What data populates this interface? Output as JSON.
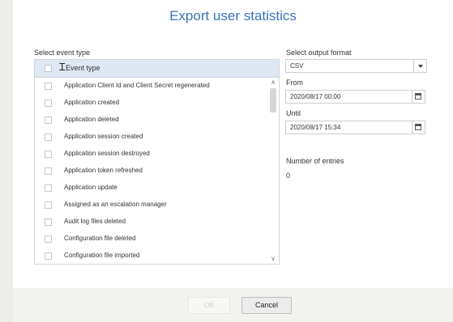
{
  "dialog": {
    "title": "Export user statistics",
    "ok_label": "OK",
    "cancel_label": "Cancel"
  },
  "event_type": {
    "label": "Select event type",
    "header": "Event type",
    "items": [
      "Application Client Id and Client Secret regenerated",
      "Application created",
      "Application deleted",
      "Application session created",
      "Application session destroyed",
      "Application token refreshed",
      "Application update",
      "Assigned as an escalation manager",
      "Audit log files deleted",
      "Configuration file deleted",
      "Configuration file imported"
    ]
  },
  "output_format": {
    "label": "Select output format",
    "value": "CSV"
  },
  "from": {
    "label": "From",
    "value": "2020/08/17 00:00"
  },
  "until": {
    "label": "Until",
    "value": "2020/08/17 15:34"
  },
  "entries": {
    "label": "Number of entries",
    "value": "0"
  },
  "icons": {
    "dropdown": "chevron-down-icon",
    "calendar": "calendar-icon",
    "scroll_up": "chevron-up-icon",
    "scroll_down": "chevron-down-icon",
    "cursor": "text-cursor-icon"
  },
  "colors": {
    "title": "#3a73b8",
    "header_bg": "#dfe8f2",
    "background": "#ecece8"
  }
}
